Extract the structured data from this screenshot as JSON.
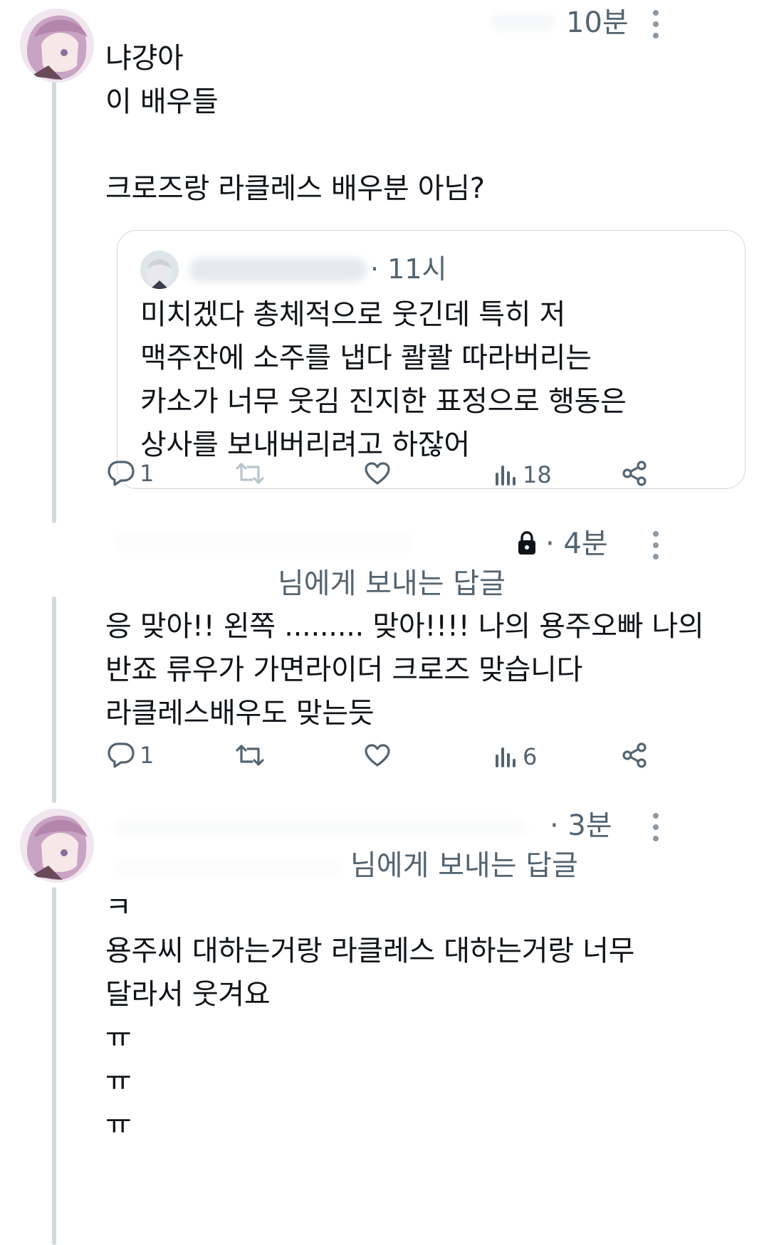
{
  "tweets": [
    {
      "time": "10분",
      "text": "냐걍아\n이 배우들\n\n크로즈랑 라클레스 배우분 아님?",
      "quote": {
        "time": "· 11시",
        "text": "미치겠다 총체적으로 웃긴데 특히 저\n맥주잔에 소주를 냅다 콸콸 따라버리는\n카소가 너무 웃김 진지한 표정으로 행동은\n상사를 보내버리려고 하잖어"
      },
      "actions": {
        "replies": "1",
        "views": "18"
      }
    },
    {
      "time": "· 4분",
      "reply_to": "님에게 보내는 답글",
      "text": "응 맞아!! 왼쪽 ......... 맞아!!!! 나의 용주오빠 나의\n반죠 류우가 가면라이더 크로즈 맞습니다\n라클레스배우도 맞는듯",
      "actions": {
        "replies": "1",
        "views": "6"
      }
    },
    {
      "time": "· 3분",
      "reply_to": "님에게 보내는 답글",
      "text": "ㅋ\n용주씨 대하는거랑 라클레스 대하는거랑 너무\n달라서 웃겨요\nㅠ\nㅠ\nㅠ"
    }
  ],
  "icons": {
    "reply": "reply-icon",
    "retweet": "retweet-icon",
    "like": "heart-icon",
    "views": "views-icon",
    "share": "share-icon",
    "more": "more-icon",
    "lock": "lock-icon"
  },
  "colors": {
    "text": "#0f1419",
    "muted": "#536471",
    "line": "#cfd9de"
  }
}
